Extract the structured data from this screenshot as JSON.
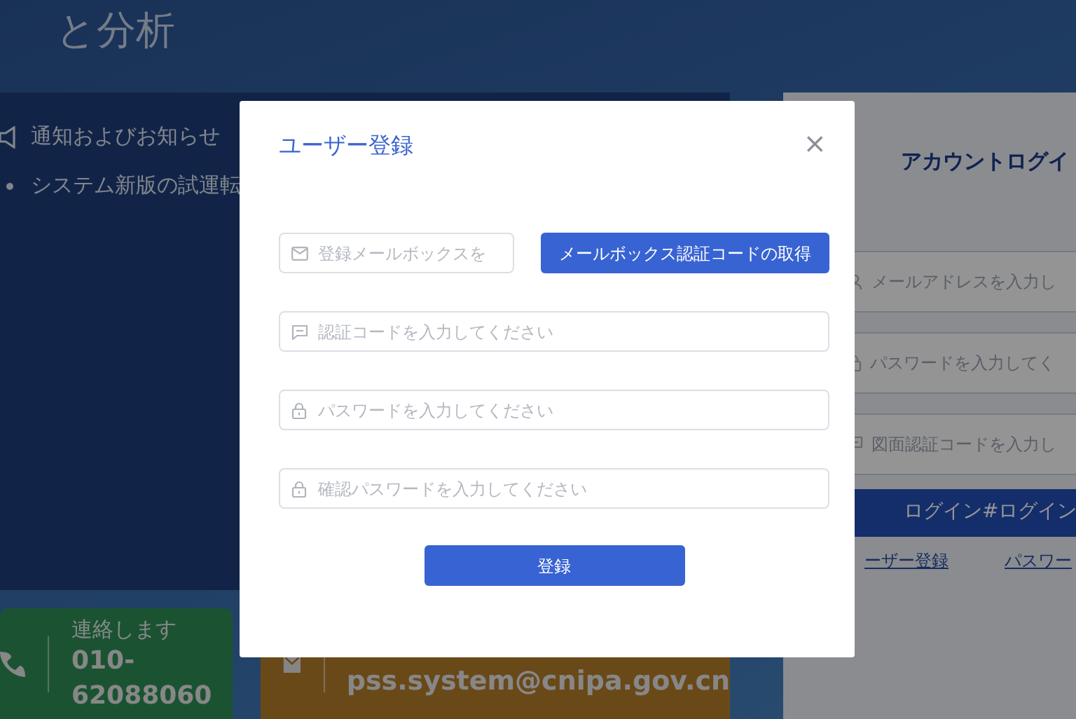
{
  "page": {
    "hero_title": "と分析",
    "notices": [
      {
        "kind": "heading",
        "text": "通知およびお知らせ"
      },
      {
        "kind": "item",
        "text": "システム新版の試運転"
      }
    ],
    "contacts": [
      {
        "kind": "phone",
        "label": "連絡します",
        "value": "010-62088060"
      },
      {
        "kind": "email",
        "value": "pss.system@cnipa.gov.cn"
      }
    ],
    "login": {
      "title": "アカウントログイ",
      "fields": [
        {
          "kind": "user",
          "placeholder": "メールアドレスを入力し"
        },
        {
          "kind": "lock",
          "placeholder": "パスワードを入力してく"
        },
        {
          "kind": "code",
          "placeholder": "図面認証コードを入力し"
        }
      ],
      "button": "ログイン#ログイン",
      "links": [
        "ーザー登録",
        "パスワー"
      ]
    }
  },
  "dialog": {
    "title": "ユーザー登録",
    "close": "×",
    "email_field": {
      "placeholder": "登録メールボックスを"
    },
    "code_button": "メールボックス認証コードの取得",
    "fields": [
      {
        "kind": "code",
        "placeholder": "認証コードを入力してください"
      },
      {
        "kind": "lock",
        "placeholder": "パスワードを入力してください"
      },
      {
        "kind": "lock",
        "placeholder": "確認パスワードを入力してください"
      }
    ],
    "submit": "登録"
  }
}
